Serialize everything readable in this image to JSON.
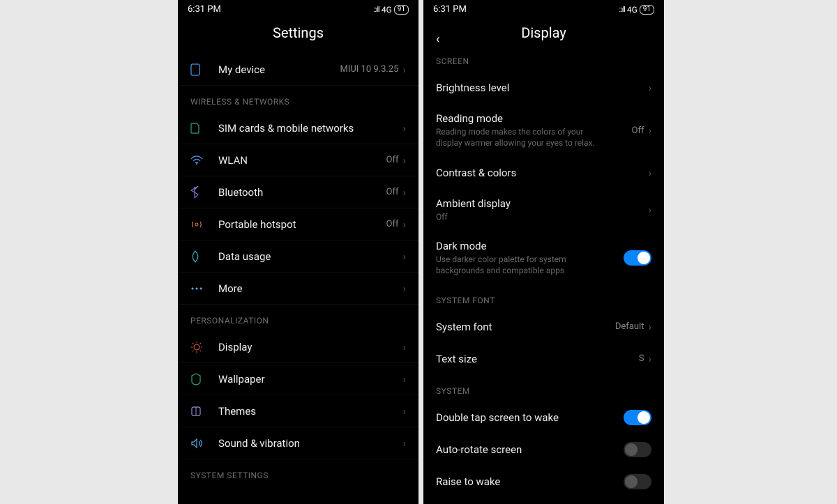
{
  "status": {
    "time": "6:31  PM",
    "net": "4G",
    "battery": "91"
  },
  "left": {
    "title": "Settings",
    "device": {
      "label": "My device",
      "value": "MIUI 10 9.3.25"
    },
    "sec_wireless": "WIRELESS & NETWORKS",
    "items_wireless": [
      {
        "label": "SIM cards & mobile networks",
        "value": ""
      },
      {
        "label": "WLAN",
        "value": "Off"
      },
      {
        "label": "Bluetooth",
        "value": "Off"
      },
      {
        "label": "Portable hotspot",
        "value": "Off"
      },
      {
        "label": "Data usage",
        "value": ""
      },
      {
        "label": "More",
        "value": ""
      }
    ],
    "sec_personal": "PERSONALIZATION",
    "items_personal": [
      {
        "label": "Display"
      },
      {
        "label": "Wallpaper"
      },
      {
        "label": "Themes"
      },
      {
        "label": "Sound & vibration"
      }
    ],
    "sec_system": "SYSTEM SETTINGS"
  },
  "right": {
    "title": "Display",
    "sec_screen": "SCREEN",
    "brightness": {
      "label": "Brightness level"
    },
    "reading": {
      "label": "Reading mode",
      "sub": "Reading mode makes the colors of your display warmer allowing your eyes to relax.",
      "value": "Off"
    },
    "contrast": {
      "label": "Contrast & colors"
    },
    "ambient": {
      "label": "Ambient display",
      "sub": "Off"
    },
    "dark": {
      "label": "Dark mode",
      "sub": "Use darker color palette for system backgrounds and compatible apps"
    },
    "sec_font": "SYSTEM FONT",
    "sysfont": {
      "label": "System font",
      "value": "Default"
    },
    "textsize": {
      "label": "Text size",
      "value": "S"
    },
    "sec_system": "SYSTEM",
    "doubletap": {
      "label": "Double tap screen to wake"
    },
    "autorotate": {
      "label": "Auto-rotate screen"
    },
    "raise": {
      "label": "Raise to wake"
    }
  }
}
